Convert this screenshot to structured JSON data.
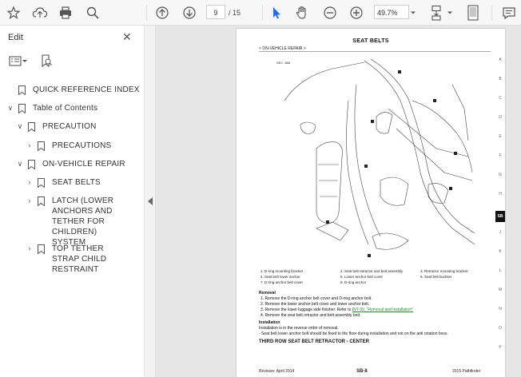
{
  "toolbar": {
    "page_current": "9",
    "page_total": "/ 15",
    "zoom": "49.7%"
  },
  "sidebar": {
    "title": "Edit",
    "items": [
      {
        "label": "QUICK REFERENCE INDEX",
        "level": 0,
        "expander": ""
      },
      {
        "label": "Table of Contents",
        "level": 0,
        "expander": "v"
      },
      {
        "label": "PRECAUTION",
        "level": 1,
        "expander": "v"
      },
      {
        "label": "PRECAUTIONS",
        "level": 2,
        "expander": ">"
      },
      {
        "label": "ON-VEHICLE REPAIR",
        "level": 1,
        "expander": "v"
      },
      {
        "label": "SEAT BELTS",
        "level": 2,
        "expander": ">"
      },
      {
        "label": "LATCH (LOWER ANCHORS AND TETHER FOR CHILDREN) SYSTEM",
        "level": 2,
        "expander": ">"
      },
      {
        "label": "TOP TETHER STRAP CHILD RESTRAINT",
        "level": 2,
        "expander": ">"
      }
    ]
  },
  "document": {
    "title": "SEAT BELTS",
    "subtitle": "< ON-VEHICLE REPAIR >",
    "side_tabs": [
      "A",
      "B",
      "C",
      "D",
      "E",
      "F",
      "G",
      "H",
      "SB",
      "J",
      "K",
      "L",
      "M",
      "N",
      "O",
      "P"
    ],
    "active_tab": "SB",
    "captions": [
      "1. D-ring mounting bracket",
      "2. Seat belt retractor and belt assembly",
      "3. Retractor mounting bracket",
      "4. Seat belt lower anchor",
      "5. Lower anchor belt cover",
      "6. Seat belt buckles",
      "7. D-ring anchor belt cover",
      "8. D-ring anchor"
    ],
    "removal_heading": "Removal",
    "removal_steps": [
      "1. Remove the D-ring anchor belt cover and D-ring anchor bolt.",
      "2. Remove the lower anchor belt cover and lower anchor bolt.",
      "3. Remove the lower luggage side finisher. Refer to ",
      "4. Remove the seat belt retractor and belt assembly bolt."
    ],
    "removal_link": "INT-39, \"Removal and Installation\"",
    "installation_heading": "Installation",
    "installation_lines": [
      "Installation is in the reverse order of removal.",
      "- Seat belt lower anchor bolt should be fixed to the floor during installation and not on the anti rotation boss."
    ],
    "section_heading": "THIRD ROW SEAT BELT RETRACTOR - CENTER",
    "footer_left": "Revision: April 2014",
    "footer_center": "SB-8",
    "footer_right": "2015 Pathfinder"
  }
}
